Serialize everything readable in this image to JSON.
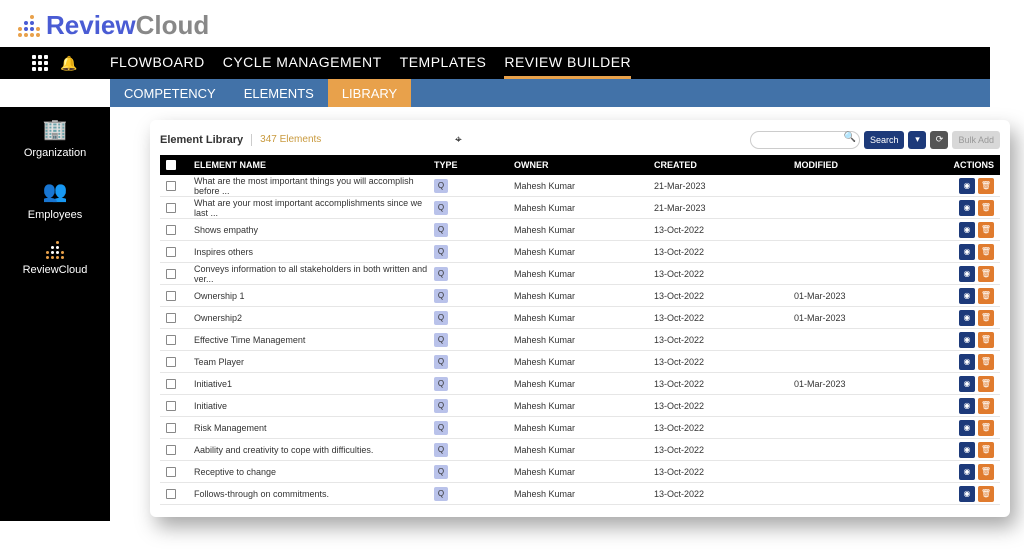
{
  "brand": {
    "part1": "Review",
    "part2": "Cloud"
  },
  "topnav": {
    "items": [
      {
        "label": "FLOWBOARD"
      },
      {
        "label": "CYCLE MANAGEMENT"
      },
      {
        "label": "TEMPLATES"
      },
      {
        "label": "REVIEW BUILDER"
      }
    ]
  },
  "subnav": {
    "items": [
      {
        "label": "COMPETENCY"
      },
      {
        "label": "ELEMENTS"
      },
      {
        "label": "LIBRARY"
      }
    ]
  },
  "sidebar": {
    "items": [
      {
        "label": "Organization"
      },
      {
        "label": "Employees"
      },
      {
        "label": "ReviewCloud"
      }
    ]
  },
  "panel": {
    "title": "Element Library",
    "count_label": "347 Elements",
    "search_btn": "Search",
    "bulk_btn": "Bulk Add"
  },
  "columns": {
    "name": "ELEMENT NAME",
    "type": "TYPE",
    "owner": "OWNER",
    "created": "CREATED",
    "modified": "MODIFIED",
    "actions": "ACTIONS"
  },
  "rows": [
    {
      "name": "What are the most important things you will accomplish before ...",
      "type": "Q",
      "owner": "Mahesh Kumar",
      "created": "21-Mar-2023",
      "modified": ""
    },
    {
      "name": "What are your most important accomplishments since we last ...",
      "type": "Q",
      "owner": "Mahesh Kumar",
      "created": "21-Mar-2023",
      "modified": ""
    },
    {
      "name": "Shows empathy",
      "type": "Q",
      "owner": "Mahesh Kumar",
      "created": "13-Oct-2022",
      "modified": ""
    },
    {
      "name": "Inspires others",
      "type": "Q",
      "owner": "Mahesh Kumar",
      "created": "13-Oct-2022",
      "modified": ""
    },
    {
      "name": "Conveys information to all stakeholders in both written and ver...",
      "type": "Q",
      "owner": "Mahesh Kumar",
      "created": "13-Oct-2022",
      "modified": ""
    },
    {
      "name": "Ownership 1",
      "type": "Q",
      "owner": "Mahesh Kumar",
      "created": "13-Oct-2022",
      "modified": "01-Mar-2023"
    },
    {
      "name": "Ownership2",
      "type": "Q",
      "owner": "Mahesh Kumar",
      "created": "13-Oct-2022",
      "modified": "01-Mar-2023"
    },
    {
      "name": "Effective Time Management",
      "type": "Q",
      "owner": "Mahesh Kumar",
      "created": "13-Oct-2022",
      "modified": ""
    },
    {
      "name": "Team Player",
      "type": "Q",
      "owner": "Mahesh Kumar",
      "created": "13-Oct-2022",
      "modified": ""
    },
    {
      "name": "Initiative1",
      "type": "Q",
      "owner": "Mahesh Kumar",
      "created": "13-Oct-2022",
      "modified": "01-Mar-2023"
    },
    {
      "name": "Initiative",
      "type": "Q",
      "owner": "Mahesh Kumar",
      "created": "13-Oct-2022",
      "modified": ""
    },
    {
      "name": "Risk Management",
      "type": "Q",
      "owner": "Mahesh Kumar",
      "created": "13-Oct-2022",
      "modified": ""
    },
    {
      "name": "Aability and creativity to cope with difficulties.",
      "type": "Q",
      "owner": "Mahesh Kumar",
      "created": "13-Oct-2022",
      "modified": ""
    },
    {
      "name": "Receptive to change",
      "type": "Q",
      "owner": "Mahesh Kumar",
      "created": "13-Oct-2022",
      "modified": ""
    },
    {
      "name": "Follows-through on commitments.",
      "type": "Q",
      "owner": "Mahesh Kumar",
      "created": "13-Oct-2022",
      "modified": ""
    }
  ]
}
